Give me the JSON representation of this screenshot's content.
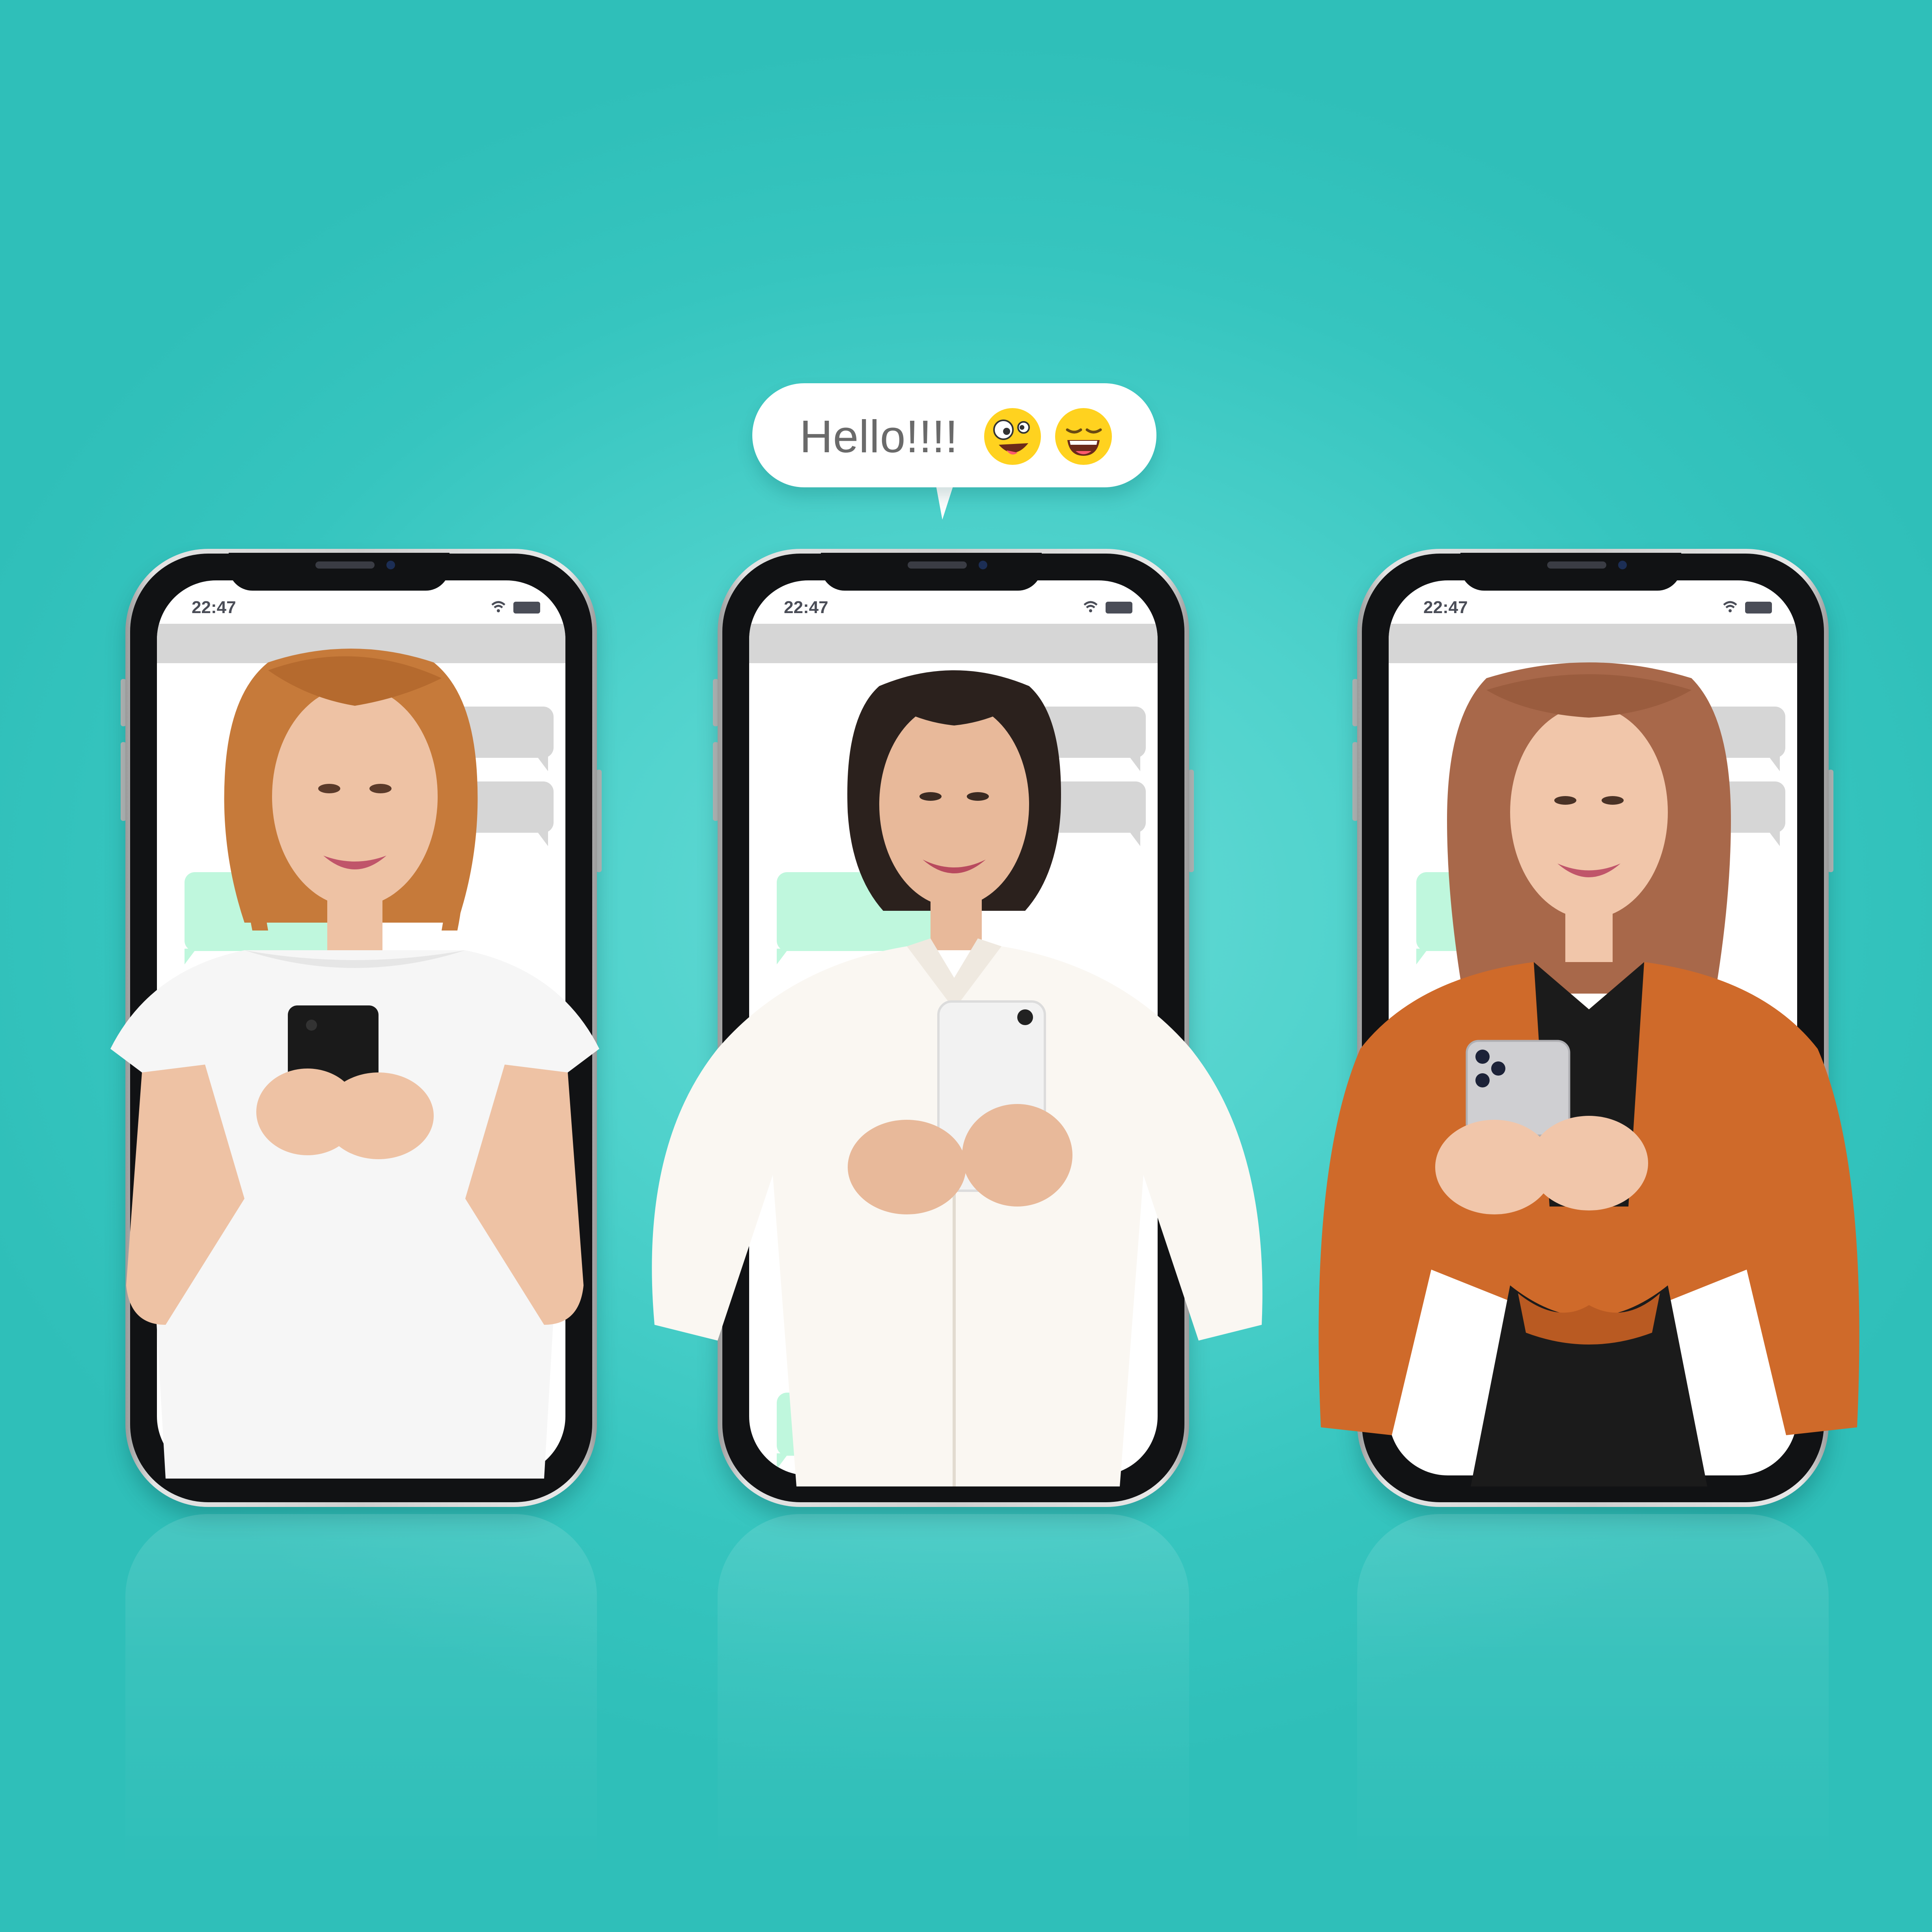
{
  "chat_bubble": {
    "text": "Hello!!!!",
    "emojis": [
      "crazy-face-emoji",
      "grinning-squinting-face-emoji"
    ]
  },
  "phones": [
    {
      "status_time": "22:47",
      "person": "woman-red-hair-white-tshirt"
    },
    {
      "status_time": "22:47",
      "person": "woman-dark-hair-white-shirt"
    },
    {
      "status_time": "22:47",
      "person": "woman-brown-hair-orange-shirt"
    }
  ],
  "colors": {
    "background": "#3cc8c2",
    "bubble_received": "#d6d6d6",
    "bubble_sent": "#bff7dd",
    "status_text": "#4a4d57"
  }
}
